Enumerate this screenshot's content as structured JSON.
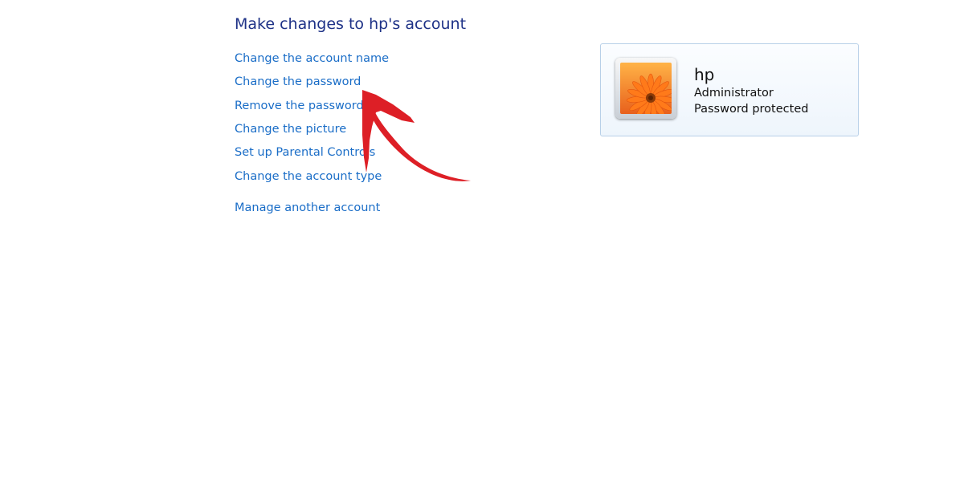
{
  "page": {
    "title": "Make changes to hp's account"
  },
  "tasks": [
    {
      "label": "Change the account name"
    },
    {
      "label": "Change the password"
    },
    {
      "label": "Remove the password"
    },
    {
      "label": "Change the picture"
    },
    {
      "label": "Set up Parental Controls"
    },
    {
      "label": "Change the account type"
    },
    {
      "label": "Manage another account"
    }
  ],
  "account": {
    "name": "hp",
    "type": "Administrator",
    "status": "Password protected",
    "picture_icon": "orange-flower-picture"
  },
  "annotation": {
    "icon": "red-arrow-icon",
    "color": "#dd1f26",
    "points_to": "Change the password"
  },
  "colors": {
    "title": "#1e3287",
    "link": "#1a6dc7"
  }
}
